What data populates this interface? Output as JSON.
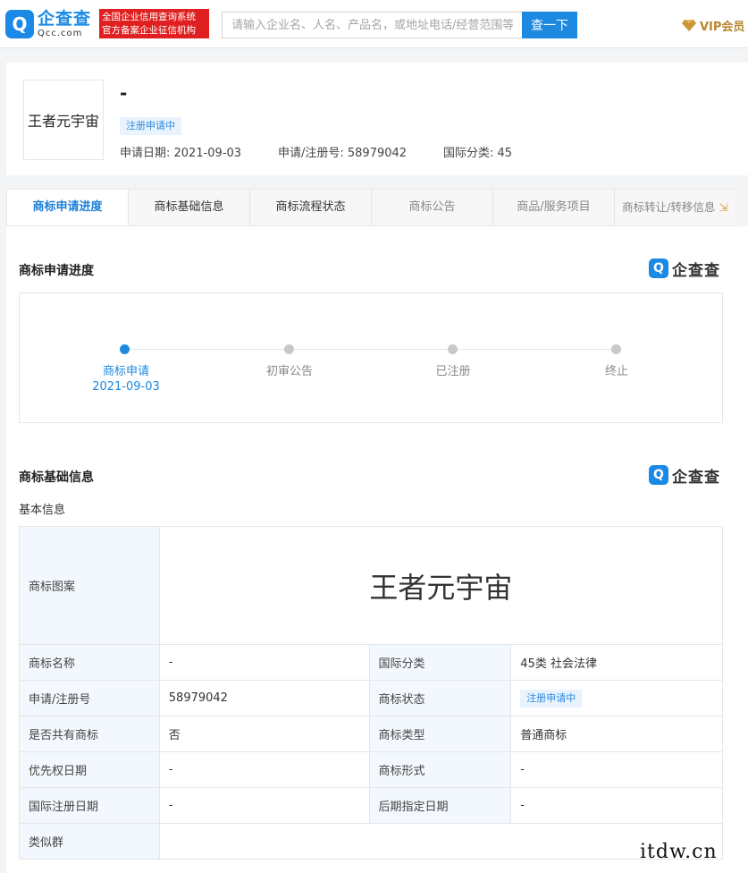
{
  "header": {
    "logo_mark": "Q",
    "logo_cn": "企查查",
    "logo_en": "Qcc.com",
    "badge_line1": "全国企业信用查询系统",
    "badge_line2": "官方备案企业征信机构",
    "search_placeholder": "请输入企业名、人名、产品名，或地址电话/经营范围等",
    "search_button": "查一下",
    "vip_label": "VIP会员"
  },
  "trademark": {
    "image_text": "王者元宇宙",
    "name": "-",
    "status_tag": "注册申请中",
    "apply_date_label": "申请日期: 2021-09-03",
    "reg_no_label": "申请/注册号: 58979042",
    "intl_class_label": "国际分类: 45"
  },
  "tabs": [
    {
      "label": "商标申请进度"
    },
    {
      "label": "商标基础信息"
    },
    {
      "label": "商标流程状态"
    },
    {
      "label": "商标公告"
    },
    {
      "label": "商品/服务项目"
    },
    {
      "label": "商标转让/转移信息"
    }
  ],
  "tab_arrow": "⇲",
  "watermark": {
    "mark": "Q",
    "text": "企查查"
  },
  "progress": {
    "title": "商标申请进度",
    "steps": [
      {
        "label": "商标申请",
        "date": "2021-09-03"
      },
      {
        "label": "初审公告"
      },
      {
        "label": "已注册"
      },
      {
        "label": "终止"
      }
    ]
  },
  "basic": {
    "title": "商标基础信息",
    "subtitle": "基本信息",
    "image_label": "商标图案",
    "image_text": "王者元宇宙",
    "rows": [
      {
        "l1": "商标名称",
        "v1": "-",
        "l2": "国际分类",
        "v2": "45类 社会法律"
      },
      {
        "l1": "申请/注册号",
        "v1": "58979042",
        "l2": "商标状态",
        "v2": "注册申请中"
      },
      {
        "l1": "是否共有商标",
        "v1": "否",
        "l2": "商标类型",
        "v2": "普通商标"
      },
      {
        "l1": "优先权日期",
        "v1": "-",
        "l2": "商标形式",
        "v2": "-"
      },
      {
        "l1": "国际注册日期",
        "v1": "-",
        "l2": "后期指定日期",
        "v2": "-"
      }
    ],
    "similar_label": "类似群"
  },
  "footer_watermark": "itdw.cn",
  "colors": {
    "accent": "#1e89e0",
    "badge_red": "#e02020",
    "vip_gold": "#b8862e"
  }
}
